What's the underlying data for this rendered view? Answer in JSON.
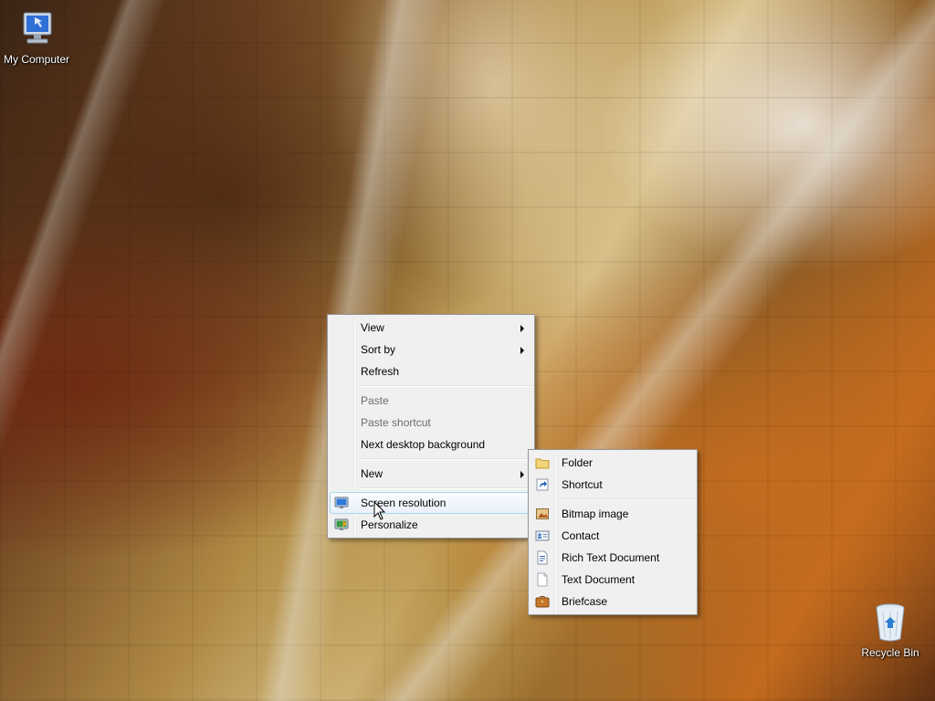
{
  "desktop": {
    "icons": [
      {
        "label": "My Computer",
        "icon": "computer-icon"
      },
      {
        "label": "Recycle Bin",
        "icon": "recycle-bin-icon"
      }
    ]
  },
  "context_menu": {
    "view": "View",
    "sort_by": "Sort by",
    "refresh": "Refresh",
    "paste": "Paste",
    "paste_shortcut": "Paste shortcut",
    "next_background": "Next desktop background",
    "new": "New",
    "screen_resolution": "Screen resolution",
    "personalize": "Personalize"
  },
  "new_submenu": {
    "folder": "Folder",
    "shortcut": "Shortcut",
    "bitmap": "Bitmap image",
    "contact": "Contact",
    "rich_text": "Rich Text Document",
    "text_document": "Text Document",
    "briefcase": "Briefcase"
  },
  "colors": {
    "menu_background": "#f0f0f0",
    "menu_border": "#979797",
    "highlight_border": "#a8d8eb",
    "disabled_text": "#6d6d6d"
  }
}
